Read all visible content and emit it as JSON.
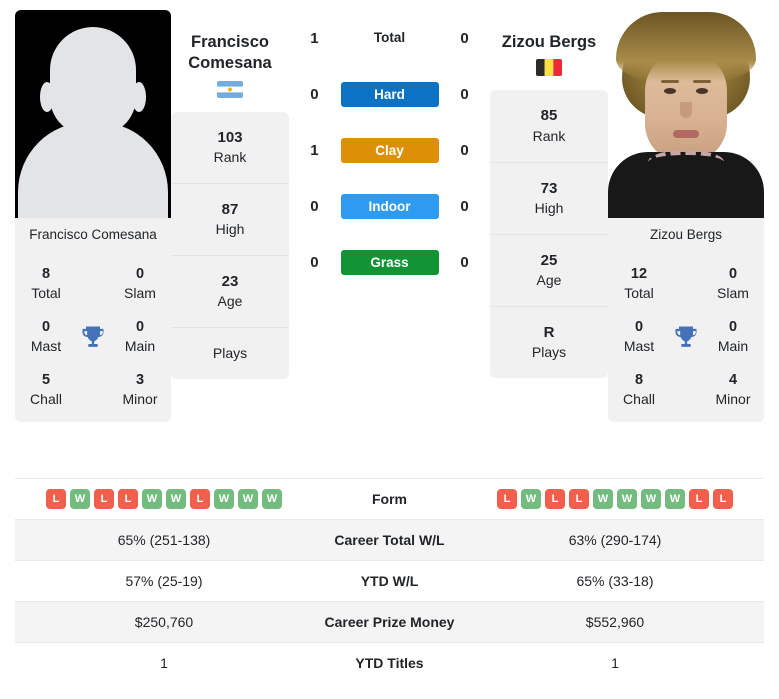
{
  "players": {
    "left": {
      "name": "Francisco Comesana",
      "name_line1": "Francisco",
      "name_line2": "Comesana",
      "photo_caption": "Francisco Comesana",
      "country": "Argentina",
      "flag_icon": "flag-argentina",
      "stats": [
        {
          "value": "103",
          "label": "Rank"
        },
        {
          "value": "87",
          "label": "High"
        },
        {
          "value": "23",
          "label": "Age"
        },
        {
          "value": "",
          "label": "Plays"
        }
      ],
      "titles": {
        "heading": "Francisco Comesana",
        "total": "8",
        "total_label": "Total",
        "slam": "0",
        "slam_label": "Slam",
        "mast": "0",
        "mast_label": "Mast",
        "main": "0",
        "main_label": "Main",
        "chall": "5",
        "chall_label": "Chall",
        "minor": "3",
        "minor_label": "Minor"
      },
      "form": [
        "L",
        "W",
        "L",
        "L",
        "W",
        "W",
        "L",
        "W",
        "W",
        "W"
      ],
      "career_wl": "65% (251-138)",
      "ytd_wl": "57% (25-19)",
      "career_prize": "$250,760",
      "ytd_titles": "1"
    },
    "right": {
      "name": "Zizou Bergs",
      "name_line1": "Zizou Bergs",
      "name_line2": "",
      "photo_caption": "Zizou Bergs",
      "country": "Belgium",
      "flag_icon": "flag-belgium",
      "stats": [
        {
          "value": "85",
          "label": "Rank"
        },
        {
          "value": "73",
          "label": "High"
        },
        {
          "value": "25",
          "label": "Age"
        },
        {
          "value": "R",
          "label": "Plays"
        }
      ],
      "titles": {
        "heading": "Zizou Bergs",
        "total": "12",
        "total_label": "Total",
        "slam": "0",
        "slam_label": "Slam",
        "mast": "0",
        "mast_label": "Mast",
        "main": "0",
        "main_label": "Main",
        "chall": "8",
        "chall_label": "Chall",
        "minor": "4",
        "minor_label": "Minor"
      },
      "form": [
        "L",
        "W",
        "L",
        "L",
        "W",
        "W",
        "W",
        "W",
        "L",
        "L"
      ],
      "career_wl": "63% (290-174)",
      "ytd_wl": "65% (33-18)",
      "career_prize": "$552,960",
      "ytd_titles": "1"
    }
  },
  "h2h": {
    "rows": [
      {
        "label": "Total",
        "left": "1",
        "right": "0",
        "type": "total",
        "color": ""
      },
      {
        "label": "Hard",
        "left": "0",
        "right": "0",
        "type": "surface",
        "color": "#0b72c4"
      },
      {
        "label": "Clay",
        "left": "1",
        "right": "0",
        "type": "surface",
        "color": "#dd8f08"
      },
      {
        "label": "Indoor",
        "left": "0",
        "right": "0",
        "type": "surface",
        "color": "#2e9bf0"
      },
      {
        "label": "Grass",
        "left": "0",
        "right": "0",
        "type": "surface",
        "color": "#129434"
      }
    ]
  },
  "comparison_table": {
    "rows": [
      {
        "label": "Form",
        "left": "",
        "right": "",
        "type": "form"
      },
      {
        "label": "Career Total W/L",
        "left": "65% (251-138)",
        "right": "63% (290-174)",
        "type": "text"
      },
      {
        "label": "YTD W/L",
        "left": "57% (25-19)",
        "right": "65% (33-18)",
        "type": "text"
      },
      {
        "label": "Career Prize Money",
        "left": "$250,760",
        "right": "$552,960",
        "type": "text"
      },
      {
        "label": "YTD Titles",
        "left": "1",
        "right": "1",
        "type": "text"
      }
    ]
  },
  "colors": {
    "hard": "#0b72c4",
    "clay": "#dd8f08",
    "indoor": "#2e9bf0",
    "grass": "#129434",
    "win": "#73bb7f",
    "loss": "#f0604d",
    "card_bg": "#f1f1f1"
  },
  "icons": {
    "trophy": "trophy-icon"
  }
}
